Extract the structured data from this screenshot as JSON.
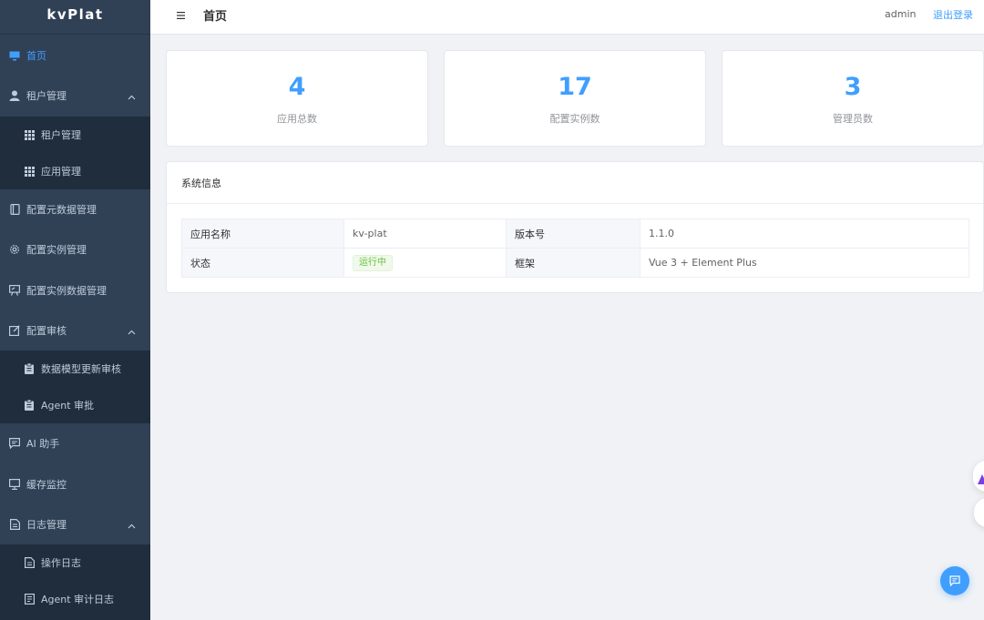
{
  "app": {
    "logo": "kvPlat"
  },
  "sidebar": {
    "items": [
      {
        "label": "首页",
        "icon": "monitor-icon",
        "active": true
      },
      {
        "label": "租户管理",
        "icon": "user-icon",
        "expanded": true
      },
      {
        "label": "租户管理",
        "icon": "grid-icon",
        "sub": true
      },
      {
        "label": "应用管理",
        "icon": "grid-icon",
        "sub": true
      },
      {
        "label": "配置元数据管理",
        "icon": "notebook-icon"
      },
      {
        "label": "配置实例管理",
        "icon": "gear-icon"
      },
      {
        "label": "配置实例数据管理",
        "icon": "presentation-icon"
      },
      {
        "label": "配置审核",
        "icon": "edit-icon",
        "expanded": true
      },
      {
        "label": "数据模型更新审核",
        "icon": "clipboard-icon",
        "sub": true
      },
      {
        "label": "Agent 审批",
        "icon": "clipboard-icon",
        "sub": true
      },
      {
        "label": "AI 助手",
        "icon": "chat-icon"
      },
      {
        "label": "缓存监控",
        "icon": "monitor-icon"
      },
      {
        "label": "日志管理",
        "icon": "document-icon",
        "expanded": true
      },
      {
        "label": "操作日志",
        "icon": "document-icon",
        "sub": true
      },
      {
        "label": "Agent 审计日志",
        "icon": "document-list-icon",
        "sub": true
      }
    ]
  },
  "header": {
    "title": "首页",
    "user": "admin",
    "logout": "退出登录"
  },
  "stats": [
    {
      "value": "4",
      "label": "应用总数"
    },
    {
      "value": "17",
      "label": "配置实例数"
    },
    {
      "value": "3",
      "label": "管理员数"
    }
  ],
  "sysinfo": {
    "title": "系统信息",
    "rows": [
      {
        "label1": "应用名称",
        "value1": "kv-plat",
        "label2": "版本号",
        "value2": "1.1.0"
      },
      {
        "label1": "状态",
        "value1": "运行中",
        "label2": "框架",
        "value2": "Vue 3 + Element Plus"
      }
    ]
  },
  "colors": {
    "accent": "#409eff",
    "sidebar_bg": "#304156",
    "success": "#67c23a"
  }
}
